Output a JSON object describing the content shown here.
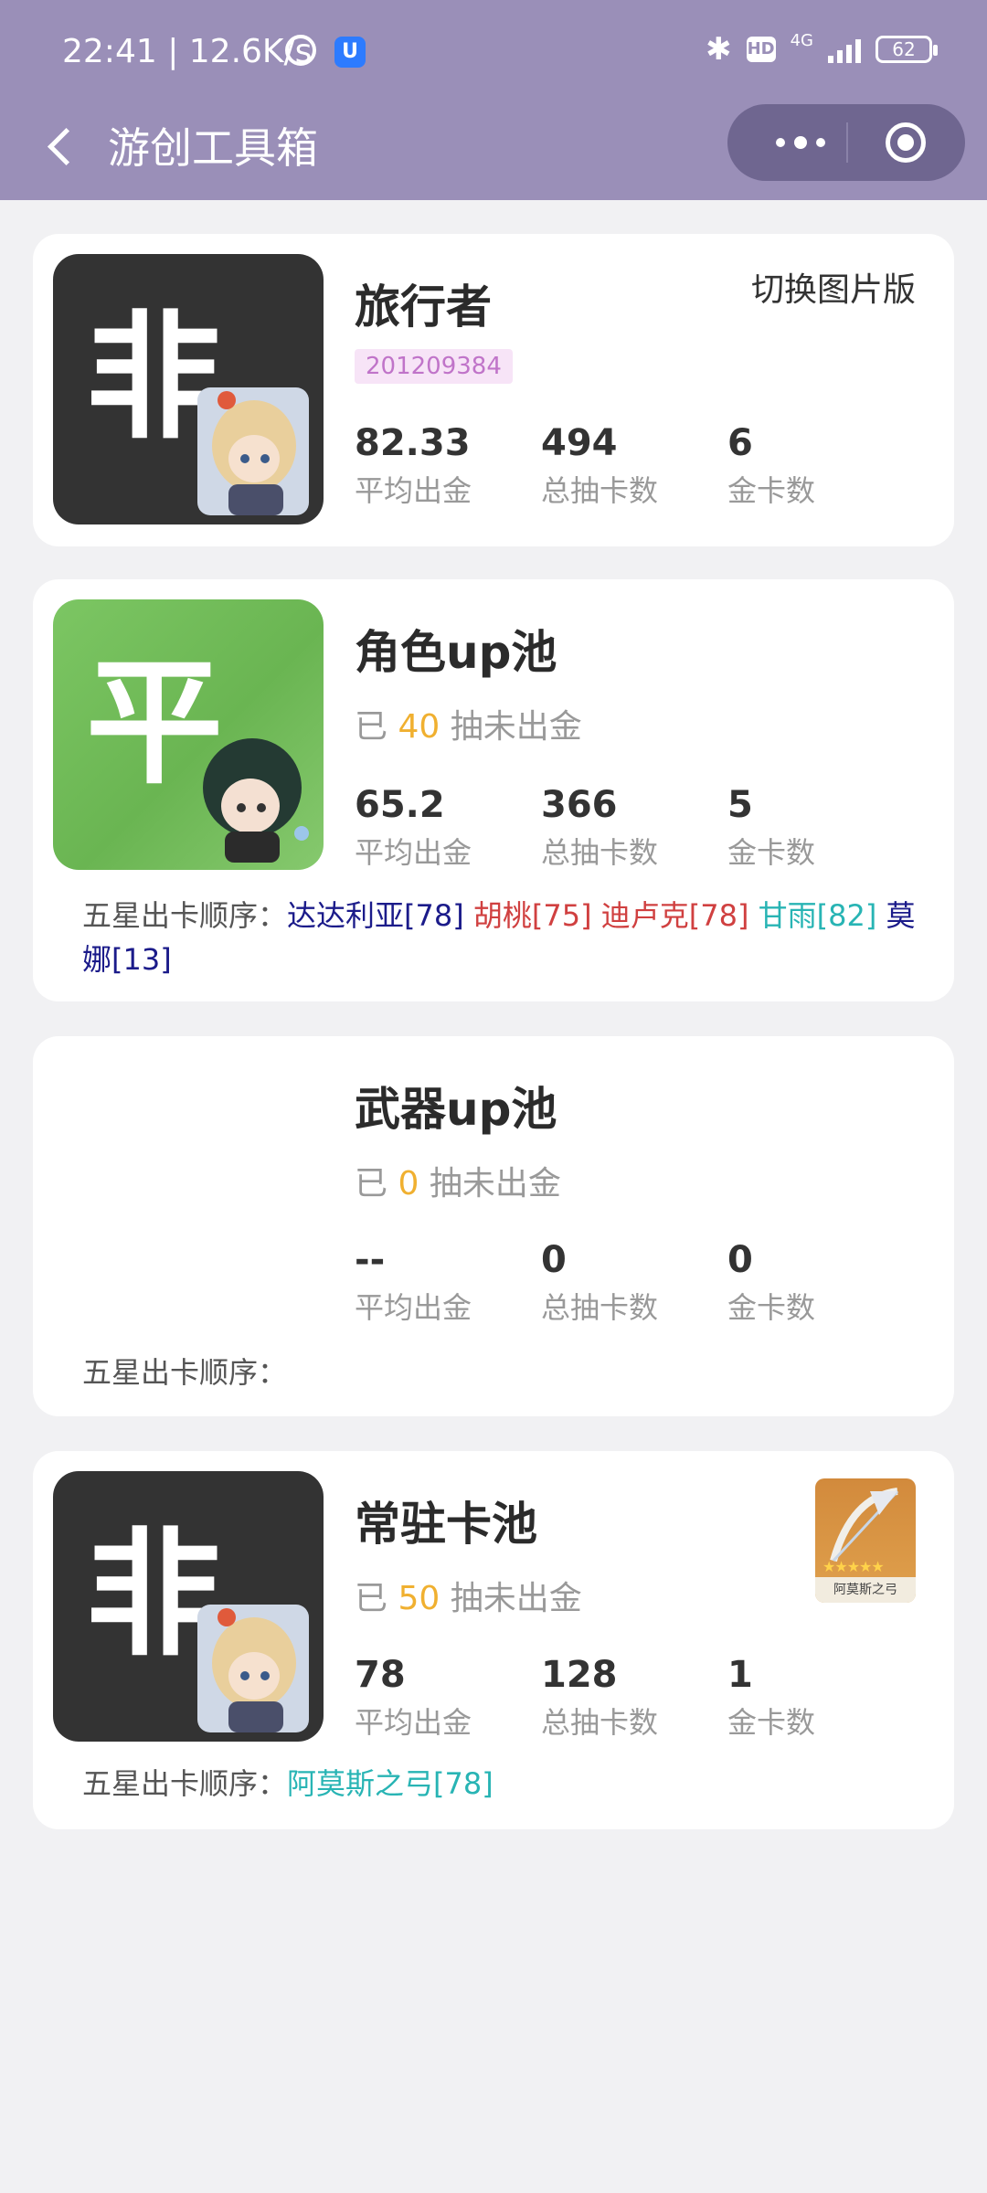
{
  "status_bar": {
    "time": "22:41 | 12.6K/s",
    "network": "4G",
    "hd": "HD",
    "battery": "62"
  },
  "nav": {
    "title": "游创工具箱"
  },
  "profile": {
    "thumb_char": "非",
    "name": "旅行者",
    "uid": "201209384",
    "switch_label": "切换图片版",
    "stats": [
      {
        "value": "82.33",
        "label": "平均出金"
      },
      {
        "value": "494",
        "label": "总抽卡数"
      },
      {
        "value": "6",
        "label": "金卡数"
      }
    ]
  },
  "pools": [
    {
      "thumb_char": "平",
      "title": "角色up池",
      "pity_prefix": "已",
      "pity_num": "40",
      "pity_suffix": "抽未出金",
      "stats": [
        {
          "value": "65.2",
          "label": "平均出金"
        },
        {
          "value": "366",
          "label": "总抽卡数"
        },
        {
          "value": "5",
          "label": "金卡数"
        }
      ],
      "order_label": "五星出卡顺序：",
      "order": [
        {
          "text": "达达利亚[78]",
          "color": "#1b1b8a"
        },
        {
          "text": "胡桃[75]",
          "color": "#d04040"
        },
        {
          "text": "迪卢克[78]",
          "color": "#d04040"
        },
        {
          "text": "甘雨[82]",
          "color": "#28b4b4"
        },
        {
          "text": "莫娜[13]",
          "color": "#1b1b8a"
        }
      ]
    },
    {
      "thumb_char": "",
      "title": "武器up池",
      "pity_prefix": "已",
      "pity_num": "0",
      "pity_suffix": "抽未出金",
      "stats": [
        {
          "value": "--",
          "label": "平均出金"
        },
        {
          "value": "0",
          "label": "总抽卡数"
        },
        {
          "value": "0",
          "label": "金卡数"
        }
      ],
      "order_label": "五星出卡顺序：",
      "order": []
    },
    {
      "thumb_char": "非",
      "title": "常驻卡池",
      "pity_prefix": "已",
      "pity_num": "50",
      "pity_suffix": "抽未出金",
      "weapon_caption": "阿莫斯之弓",
      "stats": [
        {
          "value": "78",
          "label": "平均出金"
        },
        {
          "value": "128",
          "label": "总抽卡数"
        },
        {
          "value": "1",
          "label": "金卡数"
        }
      ],
      "order_label": "五星出卡顺序：",
      "order": [
        {
          "text": "阿莫斯之弓[78]",
          "color": "#28b4b4"
        }
      ]
    }
  ]
}
